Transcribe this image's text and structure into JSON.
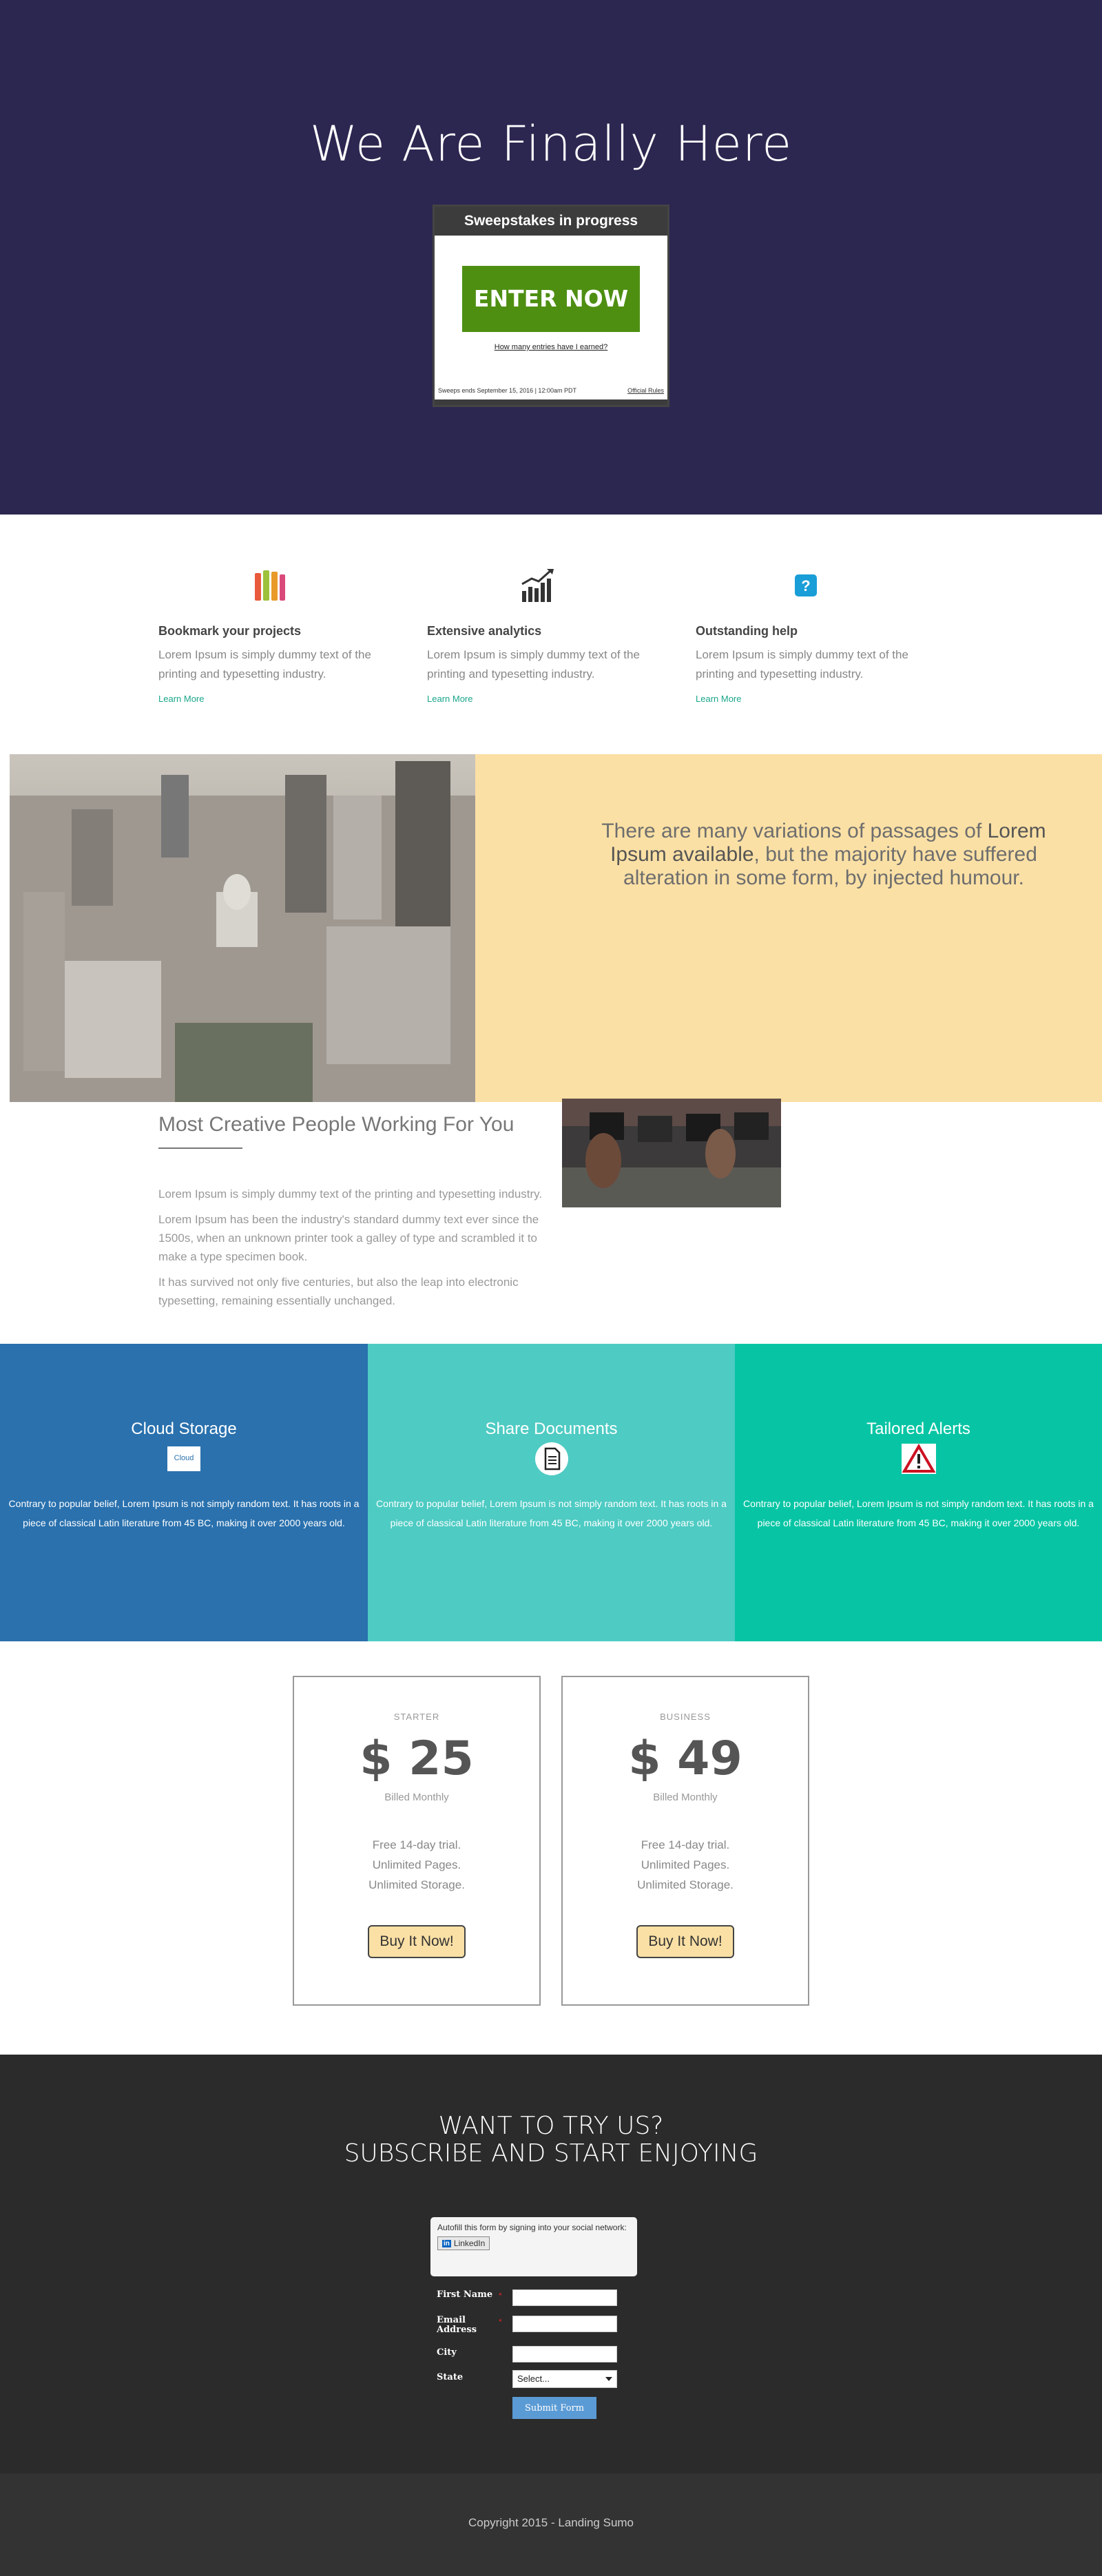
{
  "hero": {
    "title": "We Are Finally Here",
    "widget_title": "Sweepstakes in progress",
    "enter_label": "ENTER NOW",
    "entries_link": "How many entries have I earned?",
    "ends_text": "Sweeps ends September 15, 2016 | 12:00am PDT",
    "rules_link": "Official Rules"
  },
  "features": [
    {
      "icon": "pencils-icon",
      "title": "Bookmark your projects",
      "text": "Lorem Ipsum is simply dummy text of the printing and typesetting industry.",
      "link": "Learn More"
    },
    {
      "icon": "chart-icon",
      "title": "Extensive analytics",
      "text": "Lorem Ipsum is simply dummy text of the printing and typesetting industry.",
      "link": "Learn More"
    },
    {
      "icon": "help-icon",
      "title": "Outstanding help",
      "text": "Lorem Ipsum is simply dummy text of the printing and typesetting industry.",
      "link": "Learn More"
    }
  ],
  "quote": {
    "before": "There are many variations of passages of ",
    "bold": "Lorem Ipsum available",
    "after": ", but the majority have suffered alteration in some form, by injected humour."
  },
  "creative": {
    "title": "Most Creative People Working For You",
    "p1": "Lorem Ipsum is simply dummy text of the printing and typesetting industry.",
    "p2": "Lorem Ipsum has been the industry's standard dummy text ever since the 1500s, when an unknown printer took a galley of type and scrambled it to make a type specimen book.",
    "p3": "It has survived not only five centuries, but also the leap into electronic typesetting, remaining essentially unchanged."
  },
  "columns": [
    {
      "title": "Cloud Storage",
      "icon": "cloud-icon",
      "icon_text": "Cloud",
      "color": "#2a71ae",
      "text": "Contrary to popular belief, Lorem Ipsum is not simply random text. It has roots in a piece of classical Latin literature from 45 BC, making it over 2000 years old."
    },
    {
      "title": "Share Documents",
      "icon": "document-icon",
      "color": "#4ecbc3",
      "text": "Contrary to popular belief, Lorem Ipsum is not simply random text. It has roots in a piece of classical Latin literature from 45 BC, making it over 2000 years old."
    },
    {
      "title": "Tailored Alerts",
      "icon": "warning-icon",
      "color": "#07c5a4",
      "text": "Contrary to popular belief, Lorem Ipsum is not simply random text. It has roots in a piece of classical Latin literature from 45 BC, making it over 2000 years old."
    }
  ],
  "pricing": [
    {
      "plan": "STARTER",
      "price": "$ 25",
      "billed": "Billed Monthly",
      "f1": "Free 14-day trial.",
      "f2": "Unlimited Pages.",
      "f3": "Unlimited Storage.",
      "button": "Buy It Now!"
    },
    {
      "plan": "BUSINESS",
      "price": "$ 49",
      "billed": "Billed Monthly",
      "f1": "Free 14-day trial.",
      "f2": "Unlimited Pages.",
      "f3": "Unlimited Storage.",
      "button": "Buy It Now!"
    }
  ],
  "subscribe": {
    "line1": "WANT TO TRY US?",
    "line2": "SUBSCRIBE AND START ENJOYING",
    "autofill": "Autofill this form by signing into your social network:",
    "linkedin": "LinkedIn",
    "first_name": "First Name",
    "email": "Email Address",
    "city": "City",
    "state": "State",
    "state_value": "Select...",
    "required": "*",
    "submit": "Submit Form"
  },
  "footer": {
    "text": "Copyright 2015 - Landing Sumo"
  }
}
